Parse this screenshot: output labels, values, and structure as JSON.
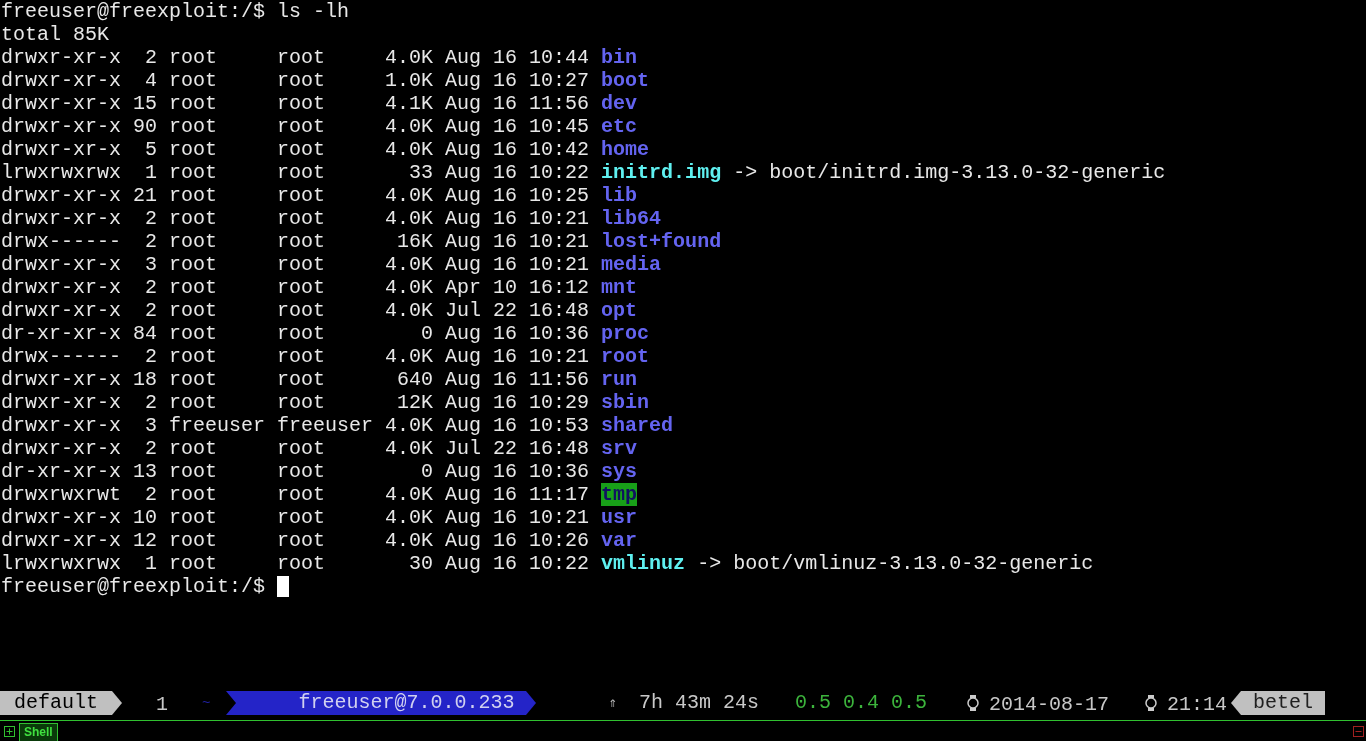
{
  "terminal": {
    "command_line": {
      "prompt": "freeuser@freexploit:/$",
      "command": "ls -lh"
    },
    "total": "total 85K",
    "entries": [
      {
        "info": "drwxr-xr-x  2 root     root     4.0K Aug 16 10:44",
        "name": "bin",
        "kind": "dir"
      },
      {
        "info": "drwxr-xr-x  4 root     root     1.0K Aug 16 10:27",
        "name": "boot",
        "kind": "dir"
      },
      {
        "info": "drwxr-xr-x 15 root     root     4.1K Aug 16 11:56",
        "name": "dev",
        "kind": "dir"
      },
      {
        "info": "drwxr-xr-x 90 root     root     4.0K Aug 16 10:45",
        "name": "etc",
        "kind": "dir"
      },
      {
        "info": "drwxr-xr-x  5 root     root     4.0K Aug 16 10:42",
        "name": "home",
        "kind": "dir"
      },
      {
        "info": "lrwxrwxrwx  1 root     root       33 Aug 16 10:22",
        "name": "initrd.img",
        "kind": "link",
        "target": "-> boot/initrd.img-3.13.0-32-generic"
      },
      {
        "info": "drwxr-xr-x 21 root     root     4.0K Aug 16 10:25",
        "name": "lib",
        "kind": "dir"
      },
      {
        "info": "drwxr-xr-x  2 root     root     4.0K Aug 16 10:21",
        "name": "lib64",
        "kind": "dir"
      },
      {
        "info": "drwx------  2 root     root      16K Aug 16 10:21",
        "name": "lost+found",
        "kind": "dir"
      },
      {
        "info": "drwxr-xr-x  3 root     root     4.0K Aug 16 10:21",
        "name": "media",
        "kind": "dir"
      },
      {
        "info": "drwxr-xr-x  2 root     root     4.0K Apr 10 16:12",
        "name": "mnt",
        "kind": "dir"
      },
      {
        "info": "drwxr-xr-x  2 root     root     4.0K Jul 22 16:48",
        "name": "opt",
        "kind": "dir"
      },
      {
        "info": "dr-xr-xr-x 84 root     root        0 Aug 16 10:36",
        "name": "proc",
        "kind": "dir"
      },
      {
        "info": "drwx------  2 root     root     4.0K Aug 16 10:21",
        "name": "root",
        "kind": "dir"
      },
      {
        "info": "drwxr-xr-x 18 root     root      640 Aug 16 11:56",
        "name": "run",
        "kind": "dir"
      },
      {
        "info": "drwxr-xr-x  2 root     root      12K Aug 16 10:29",
        "name": "sbin",
        "kind": "dir"
      },
      {
        "info": "drwxr-xr-x  3 freeuser freeuser 4.0K Aug 16 10:53",
        "name": "shared",
        "kind": "dir"
      },
      {
        "info": "drwxr-xr-x  2 root     root     4.0K Jul 22 16:48",
        "name": "srv",
        "kind": "dir"
      },
      {
        "info": "dr-xr-xr-x 13 root     root        0 Aug 16 10:36",
        "name": "sys",
        "kind": "dir"
      },
      {
        "info": "drwxrwxrwt  2 root     root     4.0K Aug 16 11:17",
        "name": "tmp",
        "kind": "sticky"
      },
      {
        "info": "drwxr-xr-x 10 root     root     4.0K Aug 16 10:21",
        "name": "usr",
        "kind": "dir"
      },
      {
        "info": "drwxr-xr-x 12 root     root     4.0K Aug 16 10:26",
        "name": "var",
        "kind": "dir"
      },
      {
        "info": "lrwxrwxrwx  1 root     root       30 Aug 16 10:22",
        "name": "vmlinuz",
        "kind": "link",
        "target": "-> boot/vmlinuz-3.13.0-32-generic"
      }
    ],
    "final_prompt": "freeuser@freexploit:/$"
  },
  "status_bar": {
    "session": "default",
    "window_index": "1",
    "window_name": "~",
    "host": "freeuser@7.0.0.233",
    "uptime_arrow": "⇑",
    "uptime": "7h 43m 24s",
    "load": "0.5 0.4 0.5",
    "date": "2014-08-17",
    "time": "21:14",
    "hostname": "betel"
  },
  "tab_bar": {
    "tabs": [
      {
        "label": "Shell",
        "selected": true
      }
    ]
  }
}
